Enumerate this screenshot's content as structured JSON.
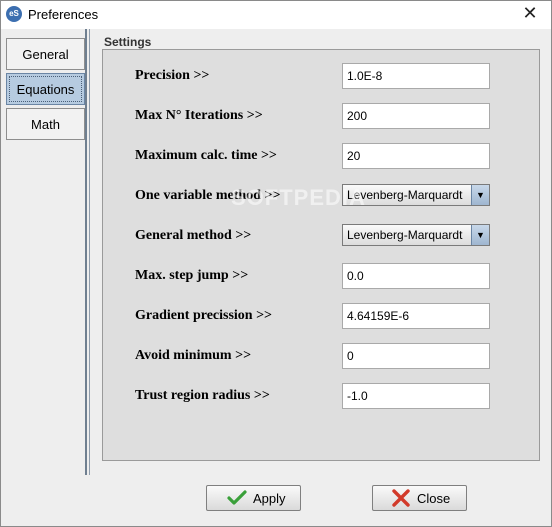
{
  "window": {
    "title": "Preferences",
    "app_icon_text": "eS"
  },
  "tabs": [
    {
      "label": "General"
    },
    {
      "label": "Equations"
    },
    {
      "label": "Math"
    }
  ],
  "settings": {
    "group_label": "Settings",
    "rows": [
      {
        "label": "Precision >>",
        "value": "1.0E-8"
      },
      {
        "label": "Max N° Iterations >>",
        "value": "200"
      },
      {
        "label": "Maximum calc. time >>",
        "value": "20"
      },
      {
        "label": "One variable method >>",
        "value": "Levenberg-Marquardt"
      },
      {
        "label": "General method >>",
        "value": "Levenberg-Marquardt"
      },
      {
        "label": "Max. step jump >>",
        "value": "0.0"
      },
      {
        "label": "Gradient precission >>",
        "value": "4.64159E-6"
      },
      {
        "label": "Avoid minimum >>",
        "value": "0"
      },
      {
        "label": "Trust region radius >>",
        "value": "-1.0"
      }
    ]
  },
  "buttons": {
    "apply": "Apply",
    "close": "Close"
  },
  "watermark": "SOFTPEDIA",
  "colors": {
    "selected_tab": "#b6cbe0",
    "apply_icon": "#3aa03a",
    "close_icon": "#d23a2a"
  }
}
